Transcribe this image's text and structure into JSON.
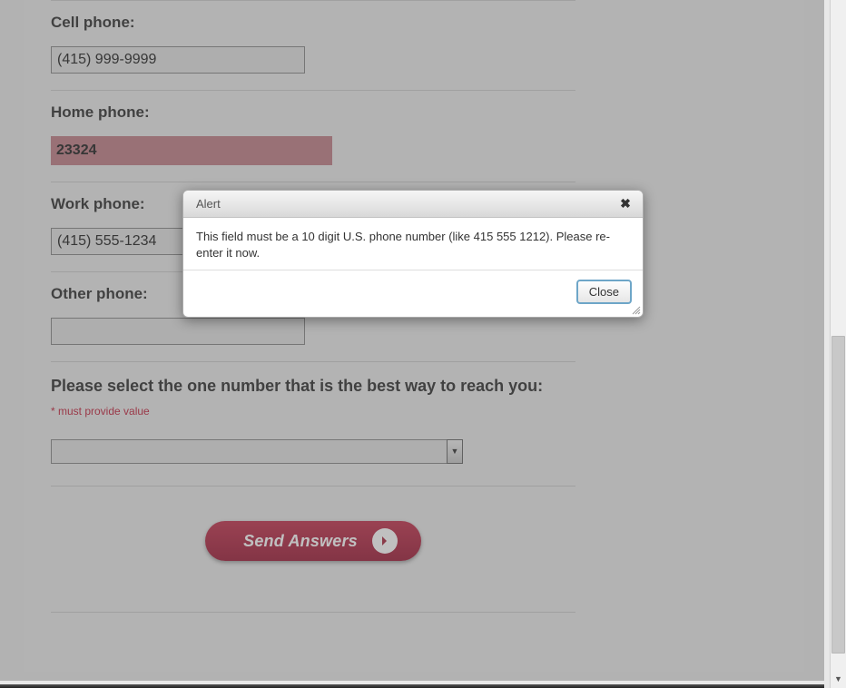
{
  "form": {
    "cell_phone": {
      "label": "Cell phone:",
      "value": "(415) 999-9999"
    },
    "home_phone": {
      "label": "Home phone:",
      "value": "23324"
    },
    "work_phone": {
      "label": "Work phone:",
      "value": "(415) 555-1234"
    },
    "other_phone": {
      "label": "Other phone:",
      "value": ""
    },
    "select_question": {
      "label": "Please select the one number that is the best way to reach you:",
      "required_note": "* must provide value",
      "value": ""
    },
    "submit_label": "Send Answers"
  },
  "dialog": {
    "title": "Alert",
    "message": "This field must be a 10 digit U.S. phone number (like 415 555 1212). Please re-enter it now.",
    "close_label": "Close"
  }
}
